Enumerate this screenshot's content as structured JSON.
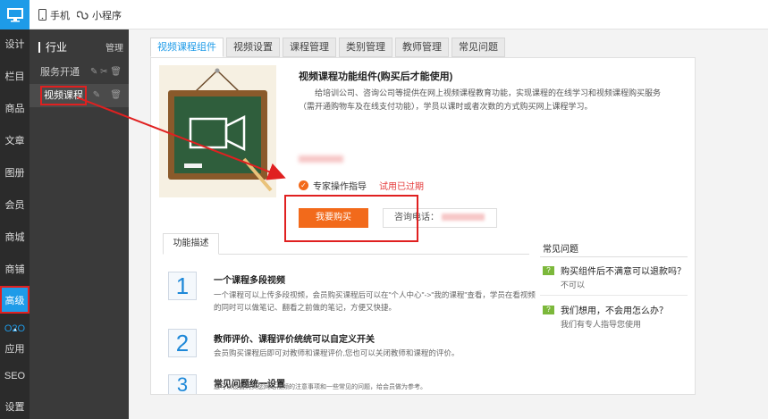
{
  "topbar": {
    "phone_label": "手机",
    "miniprogram_label": "小程序"
  },
  "leftnav": {
    "items": [
      "设计",
      "栏目",
      "商品",
      "文章",
      "图册",
      "会员",
      "商城",
      "商铺",
      "高级",
      "O2O",
      "应用",
      "SEO",
      "设置"
    ]
  },
  "subnav": {
    "title": "行业",
    "manage": "管理",
    "items": [
      "服务开通",
      "视频课程"
    ]
  },
  "tabs": [
    "视频课程组件",
    "视频设置",
    "课程管理",
    "类别管理",
    "教师管理",
    "常见问题"
  ],
  "product": {
    "title": "视频课程功能组件(购买后才能使用)",
    "desc": "给培训公司、咨询公司等提供在网上视频课程教育功能，实现课程的在线学习和视频课程购买服务（需开通购物车及在线支付功能），学员以课时或者次数的方式购买网上课程学习。",
    "expert": "专家操作指导",
    "trial": "试用已过期",
    "buy_label": "我要购买",
    "phone_label": "咨询电话："
  },
  "features": {
    "tab_label": "功能描述",
    "items": [
      {
        "num": "1",
        "title": "一个课程多段视频",
        "desc": "一个课程可以上传多段视频，会员购买课程后可以在\"个人中心\"->\"我的课程\"查看，学员在看视频的同时可以做笔记、翻看之前做的笔记，方便又快捷。"
      },
      {
        "num": "2",
        "title": "教师评价、课程评价统统可以自定义开关",
        "desc": "会员购买课程后即可对教师和课程评价,您也可以关闭教师和课程的评价。"
      },
      {
        "num": "3",
        "title": "常见问题统一设置",
        "desc": "您可以设置购买您网站视频的注意事项和一些常见的问题，给会员做为参考。"
      }
    ]
  },
  "faq": {
    "title": "常见问题",
    "items": [
      {
        "q": "购买组件后不满意可以退款吗？",
        "a": "不可以"
      },
      {
        "q": "我们想用，不会用怎么办？",
        "a": "我们有专人指导您使用"
      }
    ]
  },
  "colors": {
    "accent": "#1e9be8",
    "buy": "#f26a1b",
    "highlight": "#e02020"
  }
}
